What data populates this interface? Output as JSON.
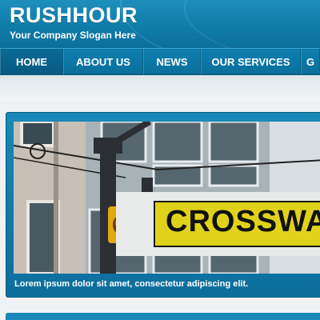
{
  "header": {
    "title": "RUSHHOUR",
    "slogan": "Your Company Slogan Here"
  },
  "nav": {
    "items": [
      {
        "label": "HOME",
        "active": true
      },
      {
        "label": "ABOUT US",
        "active": false
      },
      {
        "label": "NEWS",
        "active": false
      },
      {
        "label": "OUR SERVICES",
        "active": false
      },
      {
        "label": "G",
        "active": false
      }
    ]
  },
  "slider": {
    "sign_text": "CROSSWAL",
    "caption": "Lorem ipsum dolor sit amet, consectetur adipiscing elit."
  },
  "colors": {
    "brand_blue": "#1a88b8",
    "nav_blue": "#0d7fb0",
    "sign_yellow": "#e0d21a"
  }
}
